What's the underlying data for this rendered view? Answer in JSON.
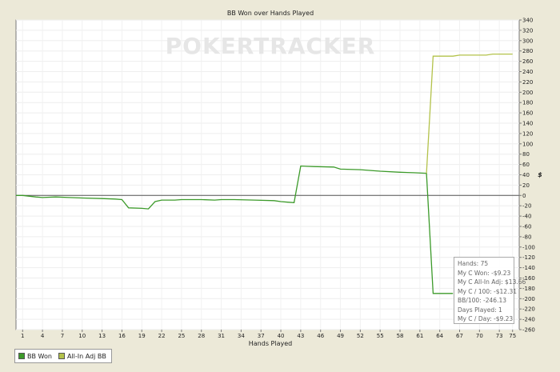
{
  "chart_data": {
    "type": "line",
    "title": "BB Won over Hands Played",
    "xlabel": "Hands Played",
    "ylabel": "$",
    "watermark": "POKERTRACKER",
    "x_ticks": [
      1,
      4,
      7,
      10,
      13,
      16,
      19,
      22,
      25,
      28,
      31,
      34,
      37,
      40,
      43,
      46,
      49,
      52,
      55,
      58,
      61,
      64,
      67,
      70,
      73,
      75
    ],
    "y_ticks": [
      340,
      320,
      300,
      280,
      260,
      240,
      220,
      200,
      180,
      160,
      140,
      120,
      100,
      80,
      60,
      40,
      20,
      0,
      -20,
      -40,
      -60,
      -80,
      -100,
      -120,
      -140,
      -160,
      -180,
      -200,
      -220,
      -240,
      -260
    ],
    "xlim": [
      0,
      76
    ],
    "ylim": [
      -260,
      340
    ],
    "grid": true,
    "legend_position": "bottom-left",
    "series": [
      {
        "name": "BB Won",
        "color": "#3c9a2a",
        "points": [
          [
            0,
            0
          ],
          [
            1,
            0
          ],
          [
            3,
            -3
          ],
          [
            4,
            -4
          ],
          [
            6,
            -3
          ],
          [
            8,
            -4
          ],
          [
            10,
            -5
          ],
          [
            13,
            -6
          ],
          [
            15,
            -7
          ],
          [
            16,
            -8
          ],
          [
            17,
            -24
          ],
          [
            19,
            -25
          ],
          [
            20,
            -26
          ],
          [
            21,
            -12
          ],
          [
            22,
            -9
          ],
          [
            24,
            -9
          ],
          [
            25,
            -8
          ],
          [
            28,
            -8
          ],
          [
            30,
            -9
          ],
          [
            31,
            -8
          ],
          [
            33,
            -8
          ],
          [
            36,
            -9
          ],
          [
            39,
            -10
          ],
          [
            40,
            -12
          ],
          [
            41,
            -13
          ],
          [
            42,
            -14
          ],
          [
            43,
            57
          ],
          [
            45,
            56
          ],
          [
            48,
            55
          ],
          [
            49,
            51
          ],
          [
            52,
            50
          ],
          [
            55,
            47
          ],
          [
            58,
            45
          ],
          [
            60,
            44
          ],
          [
            62,
            43
          ],
          [
            63,
            -190
          ],
          [
            64,
            -190
          ],
          [
            66,
            -190
          ]
        ]
      },
      {
        "name": "All-In Adj BB",
        "color": "#b3c24a",
        "points": [
          [
            62,
            43
          ],
          [
            63,
            270
          ],
          [
            66,
            270
          ],
          [
            67,
            272
          ],
          [
            71,
            272
          ],
          [
            72,
            274
          ],
          [
            75,
            274
          ]
        ]
      }
    ],
    "stats_box": [
      "Hands: 75",
      "My C Won: -$9.23",
      "My C All-In Adj: $13.66",
      "My C / 100: -$12.31",
      "BB/100: -246.13",
      "Days Played: 1",
      "My C / Day: -$9.23"
    ]
  },
  "legend": {
    "items": [
      {
        "label": "BB Won",
        "color": "#3c9a2a"
      },
      {
        "label": "All-In Adj BB",
        "color": "#b3c24a"
      }
    ]
  }
}
